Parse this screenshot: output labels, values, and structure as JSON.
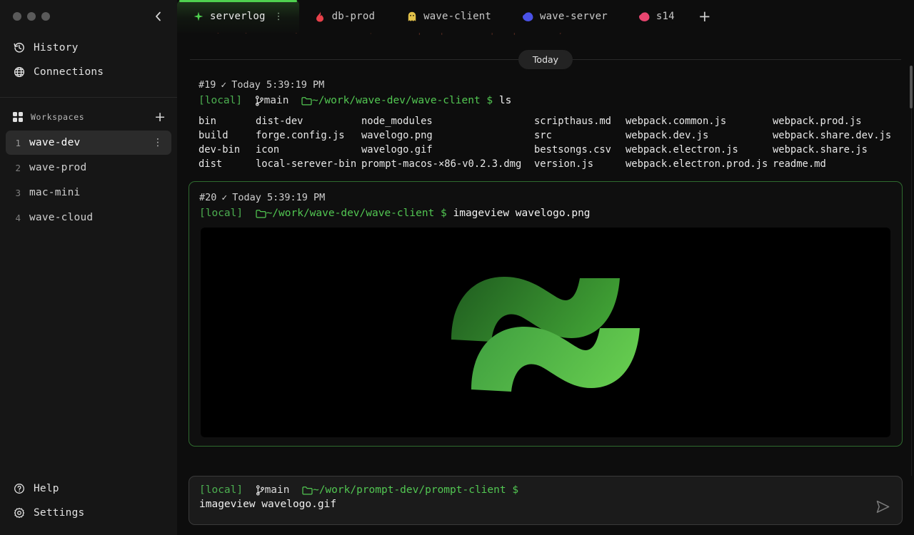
{
  "window": {
    "traffic_lights": [
      "close",
      "minimize",
      "maximize"
    ],
    "collapse_label": "‹"
  },
  "sidebar": {
    "nav": [
      {
        "label": "History",
        "icon": "history-icon"
      },
      {
        "label": "Connections",
        "icon": "globe-icon"
      }
    ],
    "workspaces_header": {
      "title": "Workspaces",
      "icon": "grid-icon",
      "add_label": "+"
    },
    "workspaces": [
      {
        "num": "1",
        "name": "wave-dev",
        "active": true,
        "menu": "⋮"
      },
      {
        "num": "2",
        "name": "wave-prod",
        "active": false,
        "menu": ""
      },
      {
        "num": "3",
        "name": "mac-mini",
        "active": false,
        "menu": ""
      },
      {
        "num": "4",
        "name": "wave-cloud",
        "active": false,
        "menu": ""
      }
    ],
    "footer": [
      {
        "label": "Help",
        "icon": "question-circle-icon"
      },
      {
        "label": "Settings",
        "icon": "gear-icon"
      }
    ]
  },
  "tabs": {
    "items": [
      {
        "label": "serverlog",
        "icon": "sparkle-icon",
        "color": "#4fd14f",
        "active": true,
        "menu": "⋮"
      },
      {
        "label": "db-prod",
        "icon": "flame-icon",
        "color": "#e8414a",
        "active": false,
        "menu": ""
      },
      {
        "label": "wave-client",
        "icon": "ghost-icon",
        "color": "#e3c24a",
        "active": false,
        "menu": ""
      },
      {
        "label": "wave-server",
        "icon": "blob-icon",
        "color": "#4a52e8",
        "active": false,
        "menu": ""
      },
      {
        "label": "s14",
        "icon": "blob-icon",
        "color": "#e8456f",
        "active": false,
        "menu": ""
      }
    ],
    "new_tab_label": "+"
  },
  "terminal": {
    "day_divider": "Today",
    "blocks": [
      {
        "id": "#19",
        "status": "✓",
        "timestamp": "Today 5:39:19 PM",
        "host": "[local]",
        "branch": "main",
        "path": "~/work/wave-dev/wave-client",
        "dollar": "$",
        "command": "ls",
        "bordered": false,
        "show_branch": true,
        "output_type": "ls-columns",
        "ls_rows": [
          [
            "bin",
            "dist-dev",
            "node_modules",
            "scripthaus.md",
            "webpack.common.js",
            "webpack.prod.js"
          ],
          [
            "build",
            "forge.config.js",
            "wavelogo.png",
            "src",
            "webpack.dev.js",
            "webpack.share.dev.js"
          ],
          [
            "dev-bin",
            "icon",
            "wavelogo.gif",
            "bestsongs.csv",
            "webpack.electron.js",
            "webpack.share.js"
          ],
          [
            "dist",
            "local-serever-bin",
            "prompt-macos-×86-v0.2.3.dmg",
            "version.js",
            "webpack.electron.prod.js",
            "readme.md"
          ]
        ]
      },
      {
        "id": "#20",
        "status": "✓",
        "timestamp": "Today 5:39:19 PM",
        "host": "[local]",
        "branch": "",
        "path": "~/work/wave-dev/wave-client",
        "dollar": "$",
        "command": "imageview wavelogo.png",
        "bordered": true,
        "show_branch": false,
        "output_type": "image",
        "image_alt": "wave-logo-image"
      }
    ]
  },
  "input": {
    "host": "[local]",
    "branch": "main",
    "path": "~/work/prompt-dev/prompt-client",
    "dollar": "$",
    "value": "imageview wavelogo.gif",
    "send_icon": "send-icon"
  },
  "colors": {
    "accent_green": "#52c752",
    "tab_active_border": "#4fd14f",
    "block_border": "#2f6b2f",
    "background": "#0d0d0d",
    "sidebar_background": "#161616",
    "logo_dark_green": "#2e7a2e",
    "logo_light_green": "#4cb84c"
  }
}
